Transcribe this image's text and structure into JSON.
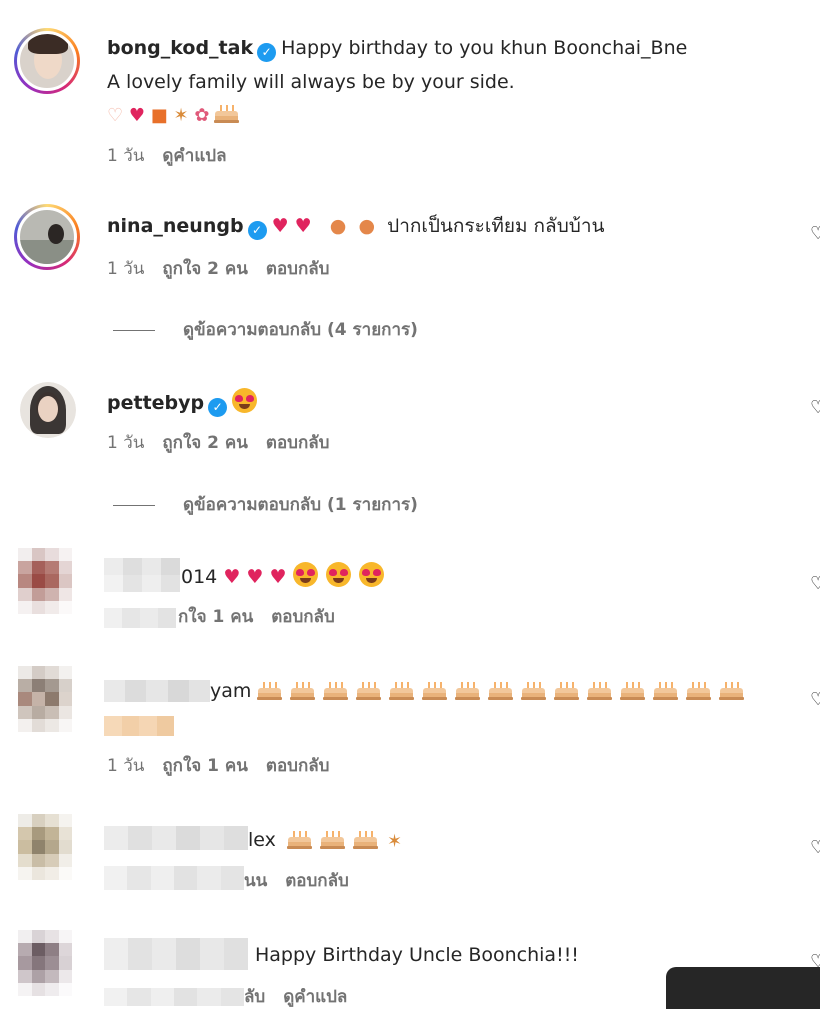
{
  "comments": [
    {
      "username": "bong_kod_tak",
      "verified": true,
      "text": "Happy birthday to you khun Boonchai_Bne",
      "text2": "A lovely family will always be by your side.",
      "emojis": "🫶 ❤️ 🎁 🎉 💐 🎂",
      "time": "1 วัน",
      "translate": "ดูคำแปล"
    },
    {
      "username": "nina_neungb",
      "verified": true,
      "text": "ปากเป็นกระเทียม กลับบ้าน",
      "emojis": "❤️ ❤️  🍲 🍲",
      "time": "1 วัน",
      "likes": "ถูกใจ 2 คน",
      "reply": "ตอบกลับ",
      "view_replies": "ดูข้อความตอบกลับ (4 รายการ)"
    },
    {
      "username": "pettebyp",
      "verified": true,
      "time": "1 วัน",
      "likes": "ถูกใจ 2 คน",
      "reply": "ตอบกลับ",
      "view_replies": "ดูข้อความตอบกลับ (1 รายการ)"
    },
    {
      "username_visible": "014",
      "likes": "กใจ 1 คน",
      "reply": "ตอบกลับ"
    },
    {
      "username_visible": "yam",
      "time": "1 วัน",
      "likes": "ถูกใจ 1 คน",
      "reply": "ตอบกลับ"
    },
    {
      "username_visible": "lex",
      "likes": "นน",
      "reply": "ตอบกลับ"
    },
    {
      "text": "Happy Birthday Uncle Boonchia!!!",
      "likes": "ลับ",
      "translate": "ดูคำแปล"
    }
  ],
  "icons": {
    "verified": "verified-badge-icon",
    "like": "heart-outline-icon"
  },
  "colors": {
    "meta": "#737373",
    "verified": "#1d9bf0",
    "text": "#262626"
  }
}
